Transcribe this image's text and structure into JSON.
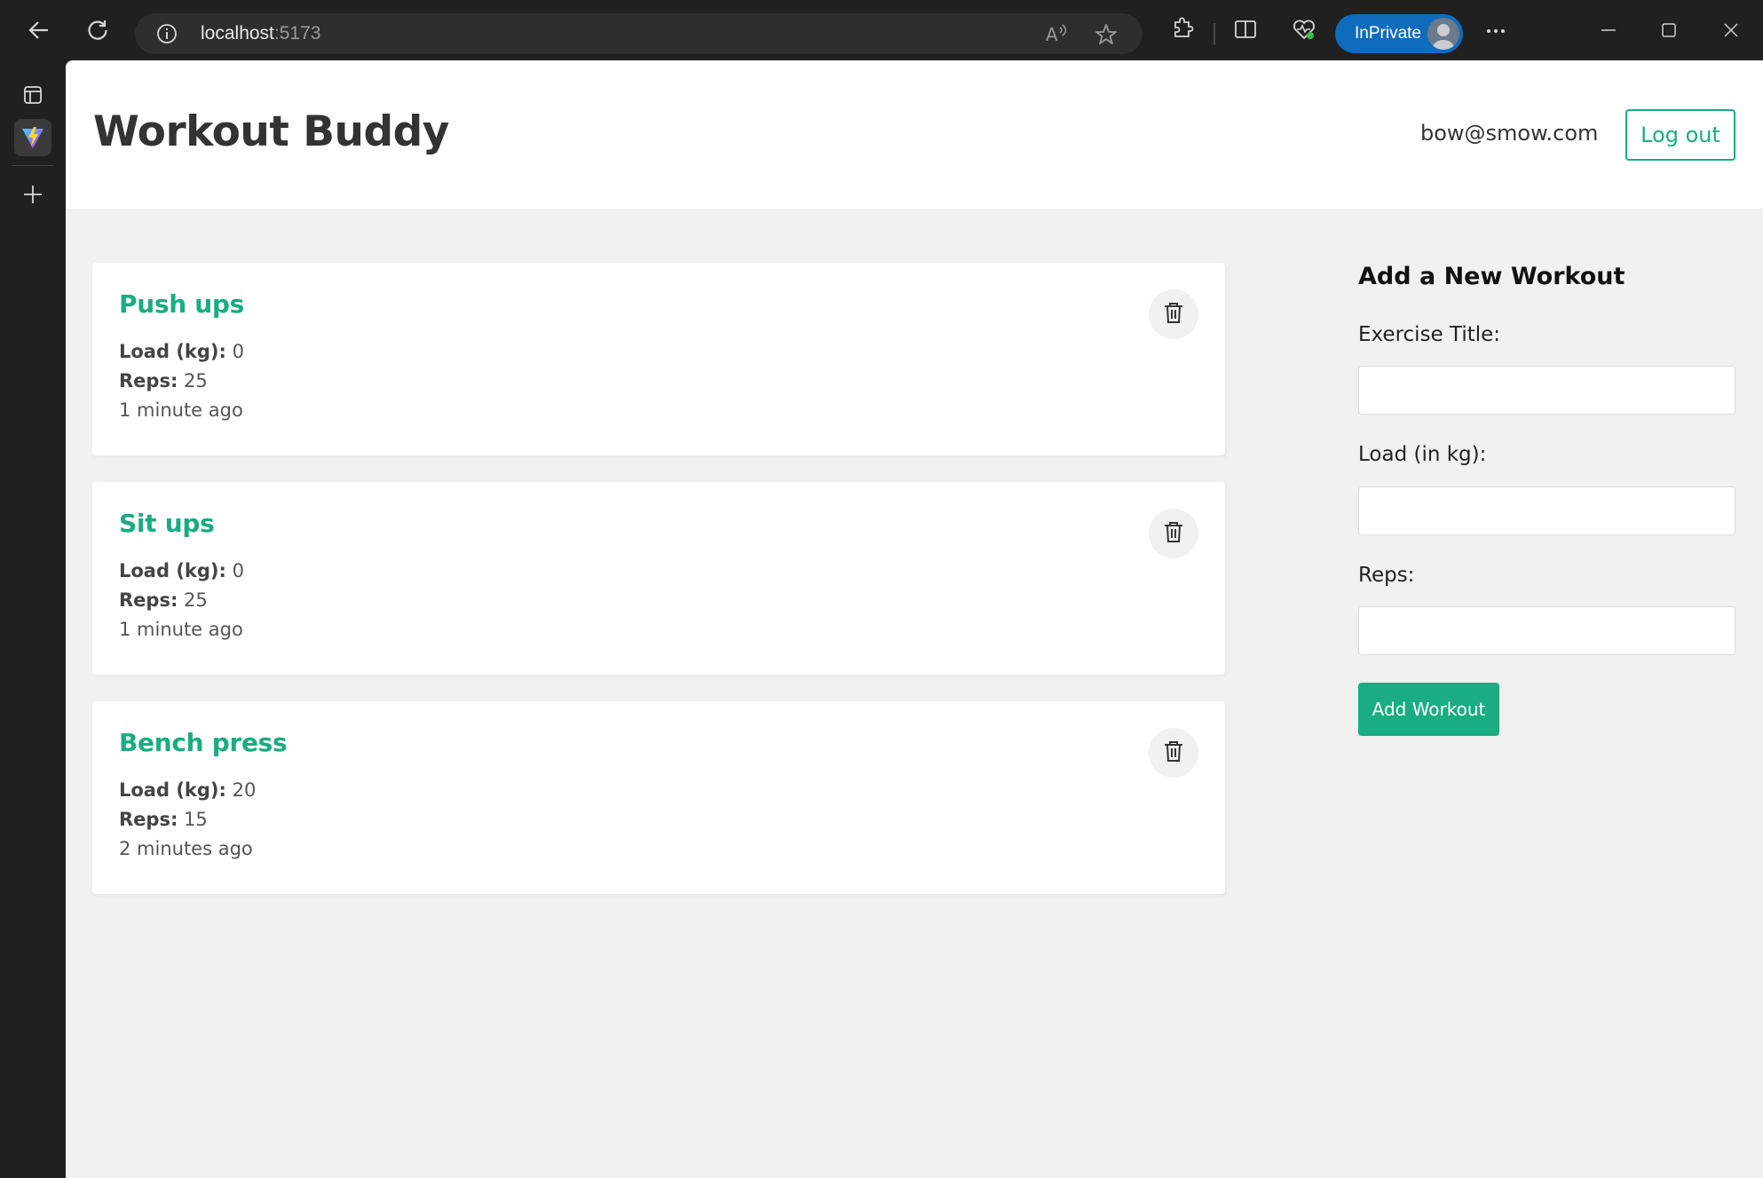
{
  "browser": {
    "url_host": "localhost",
    "url_port": ":5173",
    "inprivate_label": "InPrivate"
  },
  "header": {
    "title": "Workout Buddy",
    "user_email": "bow@smow.com",
    "logout_label": "Log out"
  },
  "workouts": [
    {
      "title": "Push ups",
      "load_label": "Load (kg):",
      "load": " 0",
      "reps_label": "Reps:",
      "reps": " 25",
      "time": "1 minute ago"
    },
    {
      "title": "Sit ups",
      "load_label": "Load (kg):",
      "load": " 0",
      "reps_label": "Reps:",
      "reps": " 25",
      "time": "1 minute ago"
    },
    {
      "title": "Bench press",
      "load_label": "Load (kg):",
      "load": " 20",
      "reps_label": "Reps:",
      "reps": " 15",
      "time": "2 minutes ago"
    }
  ],
  "form": {
    "heading": "Add a New Workout",
    "title_label": "Exercise Title:",
    "title_value": "",
    "load_label": "Load (in kg):",
    "load_value": "",
    "reps_label": "Reps:",
    "reps_value": "",
    "submit_label": "Add Workout"
  },
  "colors": {
    "accent": "#1aac83",
    "page_bg": "#f1f1f1",
    "browser_bg": "#202020",
    "inprivate": "#0f6cbd"
  },
  "icons": [
    "back-arrow-icon",
    "refresh-icon",
    "info-icon",
    "read-aloud-icon",
    "favorite-star-icon",
    "extensions-icon",
    "split-screen-icon",
    "browser-essentials-icon",
    "more-icon",
    "minimize-icon",
    "maximize-icon",
    "close-icon",
    "tab-actions-icon",
    "vite-tab-icon",
    "new-tab-icon",
    "trash-icon"
  ]
}
